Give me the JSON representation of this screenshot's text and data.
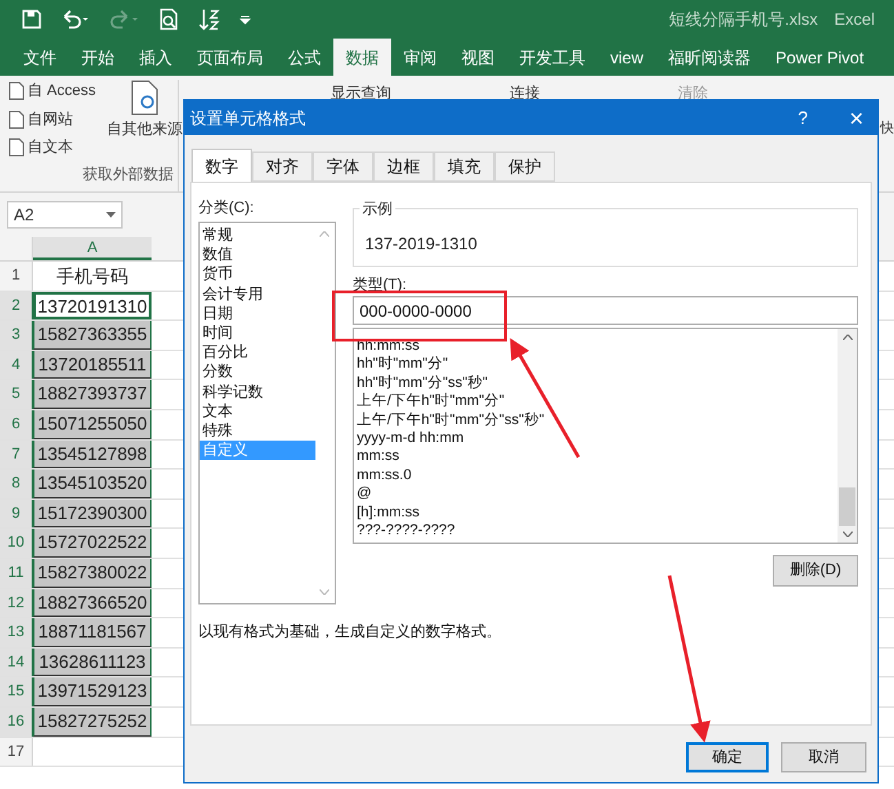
{
  "window": {
    "title": "短线分隔手机号.xlsx",
    "app": "Excel"
  },
  "ribbon_tabs": [
    {
      "label": "文件",
      "selected": false
    },
    {
      "label": "开始",
      "selected": false
    },
    {
      "label": "插入",
      "selected": false
    },
    {
      "label": "页面布局",
      "selected": false
    },
    {
      "label": "公式",
      "selected": false
    },
    {
      "label": "数据",
      "selected": true
    },
    {
      "label": "审阅",
      "selected": false
    },
    {
      "label": "视图",
      "selected": false
    },
    {
      "label": "开发工具",
      "selected": false
    },
    {
      "label": "view",
      "selected": false
    },
    {
      "label": "福昕阅读器",
      "selected": false
    },
    {
      "label": "Power Pivot",
      "selected": false
    }
  ],
  "ribbon": {
    "small_items": [
      "自 Access",
      "自网站",
      "自文本"
    ],
    "big_item": "自其他来源",
    "group_label": "获取外部数据",
    "partial_items": [
      "显示查询",
      "连接",
      "清除"
    ],
    "edge_item": "快"
  },
  "name_box": "A2",
  "sheet": {
    "column": "A",
    "rows": [
      {
        "number": "1",
        "value": "手机号码",
        "selected": false,
        "active": false
      },
      {
        "number": "2",
        "value": "13720191310",
        "selected": true,
        "active": true
      },
      {
        "number": "3",
        "value": "15827363355",
        "selected": true,
        "active": false
      },
      {
        "number": "4",
        "value": "13720185511",
        "selected": true,
        "active": false
      },
      {
        "number": "5",
        "value": "18827393737",
        "selected": true,
        "active": false
      },
      {
        "number": "6",
        "value": "15071255050",
        "selected": true,
        "active": false
      },
      {
        "number": "7",
        "value": "13545127898",
        "selected": true,
        "active": false
      },
      {
        "number": "8",
        "value": "13545103520",
        "selected": true,
        "active": false
      },
      {
        "number": "9",
        "value": "15172390300",
        "selected": true,
        "active": false
      },
      {
        "number": "10",
        "value": "15727022522",
        "selected": true,
        "active": false
      },
      {
        "number": "11",
        "value": "15827380022",
        "selected": true,
        "active": false
      },
      {
        "number": "12",
        "value": "18827366520",
        "selected": true,
        "active": false
      },
      {
        "number": "13",
        "value": "18871181567",
        "selected": true,
        "active": false
      },
      {
        "number": "14",
        "value": "13628611123",
        "selected": true,
        "active": false
      },
      {
        "number": "15",
        "value": "13971529123",
        "selected": true,
        "active": false
      },
      {
        "number": "16",
        "value": "15827275252",
        "selected": true,
        "active": false
      },
      {
        "number": "17",
        "selected": false,
        "active": false
      }
    ]
  },
  "dialog": {
    "title": "设置单元格格式",
    "help": "?",
    "close": "×",
    "tabs": [
      {
        "label": "数字",
        "selected": true
      },
      {
        "label": "对齐",
        "selected": false
      },
      {
        "label": "字体",
        "selected": false
      },
      {
        "label": "边框",
        "selected": false
      },
      {
        "label": "填充",
        "selected": false
      },
      {
        "label": "保护",
        "selected": false
      }
    ],
    "category_label": "分类(C):",
    "categories": [
      {
        "label": "常规",
        "selected": false
      },
      {
        "label": "数值",
        "selected": false
      },
      {
        "label": "货币",
        "selected": false
      },
      {
        "label": "会计专用",
        "selected": false
      },
      {
        "label": "日期",
        "selected": false
      },
      {
        "label": "时间",
        "selected": false
      },
      {
        "label": "百分比",
        "selected": false
      },
      {
        "label": "分数",
        "selected": false
      },
      {
        "label": "科学记数",
        "selected": false
      },
      {
        "label": "文本",
        "selected": false
      },
      {
        "label": "特殊",
        "selected": false
      },
      {
        "label": "自定义",
        "selected": true
      }
    ],
    "sample_label": "示例",
    "sample_value": "137-2019-1310",
    "type_label": "类型(T):",
    "type_value": "000-0000-0000",
    "formats": [
      "hh:mm:ss",
      "hh\"时\"mm\"分\"",
      "hh\"时\"mm\"分\"ss\"秒\"",
      "上午/下午h\"时\"mm\"分\"",
      "上午/下午h\"时\"mm\"分\"ss\"秒\"",
      "yyyy-m-d hh:mm",
      "mm:ss",
      "mm:ss.0",
      "@",
      "[h]:mm:ss",
      "???-????-????"
    ],
    "delete_button": "删除(D)",
    "description": "以现有格式为基础，生成自定义的数字格式。",
    "ok_button": "确定",
    "cancel_button": "取消"
  }
}
